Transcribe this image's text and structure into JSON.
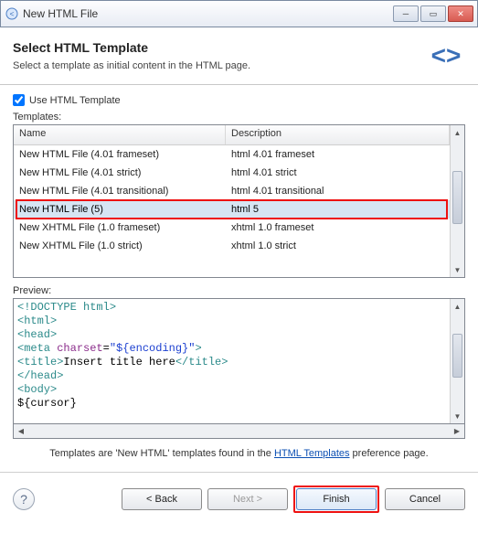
{
  "window": {
    "title": "New HTML File"
  },
  "header": {
    "title": "Select HTML Template",
    "subtitle": "Select a template as initial content in the HTML page."
  },
  "useTemplate": {
    "label": "Use HTML Template",
    "checked": true
  },
  "templates": {
    "label": "Templates:",
    "columns": {
      "name": "Name",
      "description": "Description"
    },
    "rows": [
      {
        "name": "New HTML File (4.01 frameset)",
        "description": "html 4.01 frameset",
        "selected": false
      },
      {
        "name": "New HTML File (4.01 strict)",
        "description": "html 4.01 strict",
        "selected": false
      },
      {
        "name": "New HTML File (4.01 transitional)",
        "description": "html 4.01 transitional",
        "selected": false
      },
      {
        "name": "New HTML File (5)",
        "description": "html 5",
        "selected": true
      },
      {
        "name": "New XHTML File (1.0 frameset)",
        "description": "xhtml 1.0 frameset",
        "selected": false
      },
      {
        "name": "New XHTML File (1.0 strict)",
        "description": "xhtml 1.0 strict",
        "selected": false
      }
    ]
  },
  "preview": {
    "label": "Preview:",
    "tokens": [
      {
        "t": "<!DOCTYPE",
        "c": "teal"
      },
      {
        "t": " ",
        "c": "black"
      },
      {
        "t": "html",
        "c": "teal"
      },
      {
        "t": ">",
        "c": "teal"
      },
      {
        "t": "\n",
        "c": ""
      },
      {
        "t": "<html>",
        "c": "teal"
      },
      {
        "t": "\n",
        "c": ""
      },
      {
        "t": "<head>",
        "c": "teal"
      },
      {
        "t": "\n",
        "c": ""
      },
      {
        "t": "<meta",
        "c": "teal"
      },
      {
        "t": " ",
        "c": "black"
      },
      {
        "t": "charset",
        "c": "purple"
      },
      {
        "t": "=",
        "c": "black"
      },
      {
        "t": "\"${encoding}\"",
        "c": "blue"
      },
      {
        "t": ">",
        "c": "teal"
      },
      {
        "t": "\n",
        "c": ""
      },
      {
        "t": "<title>",
        "c": "teal"
      },
      {
        "t": "Insert title here",
        "c": "black"
      },
      {
        "t": "</title>",
        "c": "teal"
      },
      {
        "t": "\n",
        "c": ""
      },
      {
        "t": "</head>",
        "c": "teal"
      },
      {
        "t": "\n",
        "c": ""
      },
      {
        "t": "<body>",
        "c": "teal"
      },
      {
        "t": "\n",
        "c": ""
      },
      {
        "t": "${cursor}",
        "c": "black"
      }
    ]
  },
  "hint": {
    "before": "Templates are 'New HTML' templates found in the ",
    "link": "HTML Templates",
    "after": " preference page."
  },
  "buttons": {
    "back": "< Back",
    "next": "Next >",
    "finish": "Finish",
    "cancel": "Cancel"
  }
}
